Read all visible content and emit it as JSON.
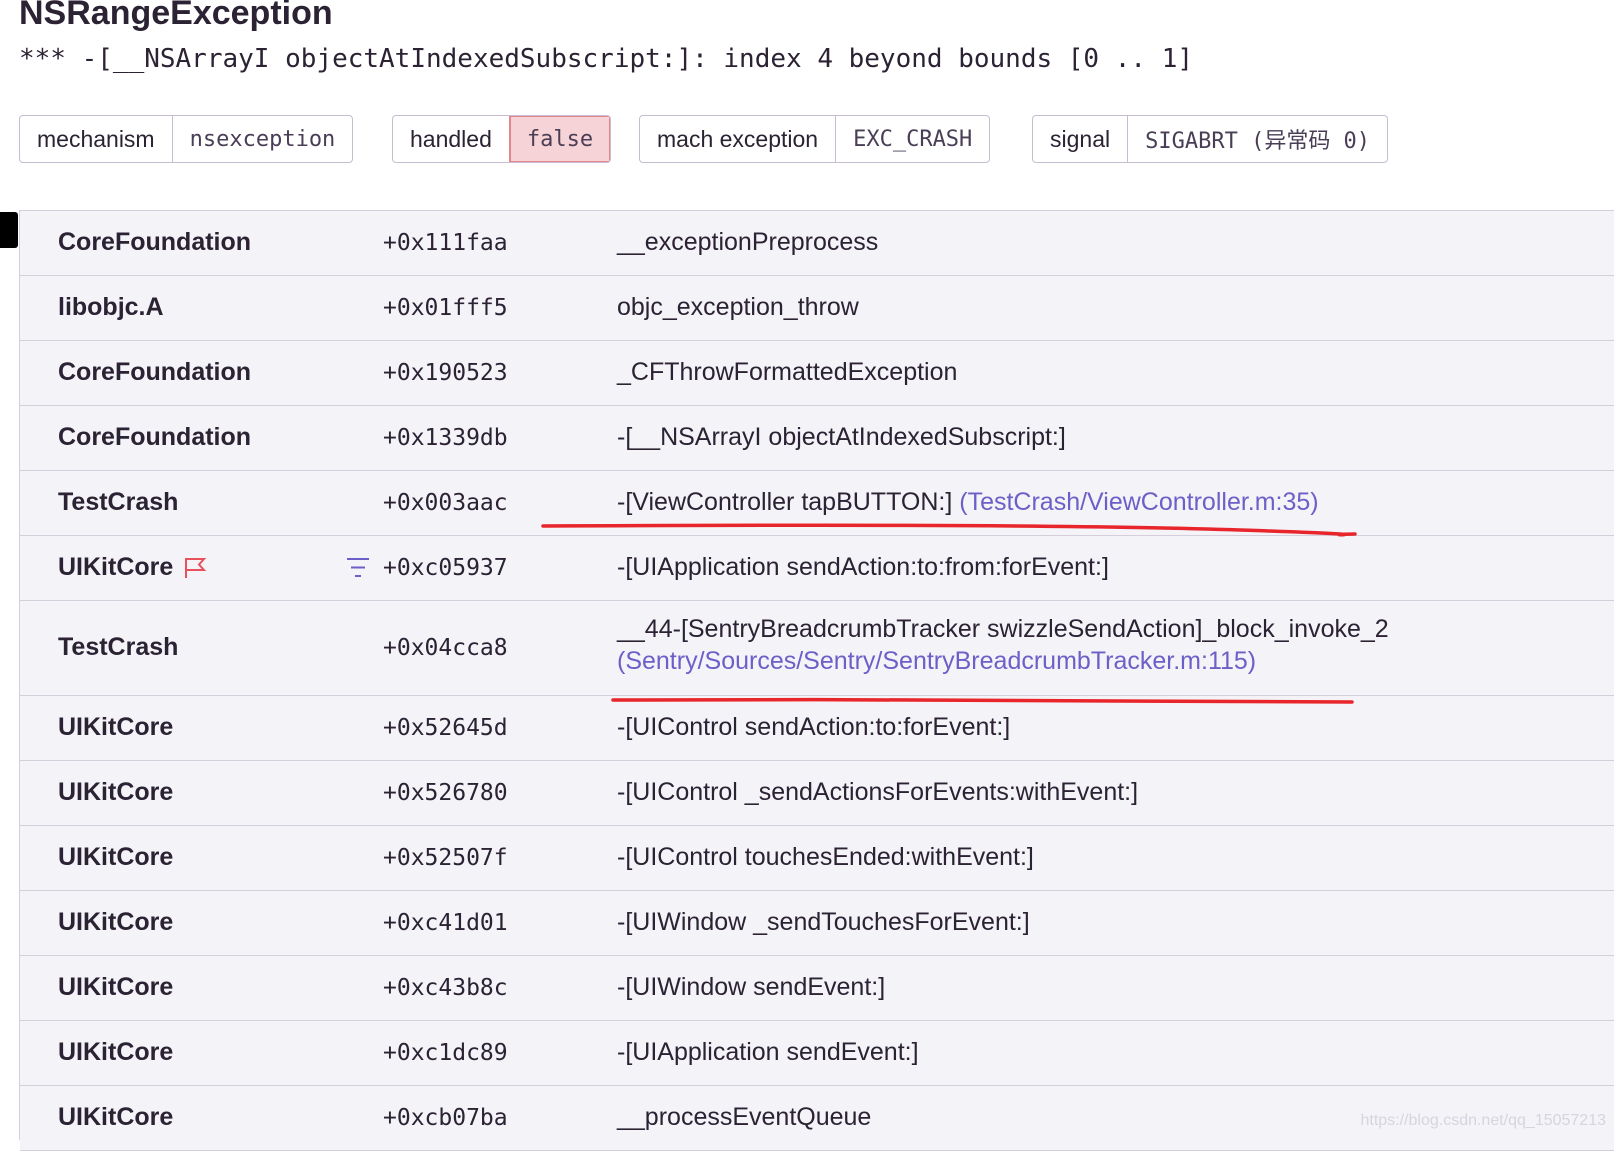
{
  "exception": {
    "type": "NSRangeException",
    "message": "*** -[__NSArrayI objectAtIndexedSubscript:]: index 4 beyond bounds [0 .. 1]"
  },
  "tags": [
    {
      "key": "mechanism",
      "value": "nsexception",
      "highlight": false
    },
    {
      "key": "handled",
      "value": "false",
      "highlight": true
    },
    {
      "key": "mach exception",
      "value": "EXC_CRASH",
      "highlight": false
    },
    {
      "key": "signal",
      "value": "SIGABRT (异常码 0)",
      "highlight": false
    }
  ],
  "frames": [
    {
      "package": "CoreFoundation",
      "address": "+0x111faa",
      "function": "__exceptionPreprocess"
    },
    {
      "package": "libobjc.A",
      "address": "+0x01fff5",
      "function": "objc_exception_throw"
    },
    {
      "package": "CoreFoundation",
      "address": "+0x190523",
      "function": "_CFThrowFormattedException"
    },
    {
      "package": "CoreFoundation",
      "address": "+0x1339db",
      "function": "-[__NSArrayI objectAtIndexedSubscript:]"
    },
    {
      "package": "TestCrash",
      "address": "+0x003aac",
      "function": "-[ViewController tapBUTTON:]",
      "location": "(TestCrash/ViewController.m:35)"
    },
    {
      "package": "UIKitCore",
      "address": "+0xc05937",
      "function": "-[UIApplication sendAction:to:from:forEvent:]",
      "flag": true
    },
    {
      "package": "TestCrash",
      "address": "+0x04cca8",
      "function": "__44-[SentryBreadcrumbTracker swizzleSendAction]_block_invoke_2",
      "location": "(Sentry/Sources/Sentry/SentryBreadcrumbTracker.m:115)"
    },
    {
      "package": "UIKitCore",
      "address": "+0x52645d",
      "function": "-[UIControl sendAction:to:forEvent:]"
    },
    {
      "package": "UIKitCore",
      "address": "+0x526780",
      "function": "-[UIControl _sendActionsForEvents:withEvent:]"
    },
    {
      "package": "UIKitCore",
      "address": "+0x52507f",
      "function": "-[UIControl touchesEnded:withEvent:]"
    },
    {
      "package": "UIKitCore",
      "address": "+0xc41d01",
      "function": "-[UIWindow _sendTouchesForEvent:]"
    },
    {
      "package": "UIKitCore",
      "address": "+0xc43b8c",
      "function": "-[UIWindow sendEvent:]"
    },
    {
      "package": "UIKitCore",
      "address": "+0xc1dc89",
      "function": "-[UIApplication sendEvent:]"
    },
    {
      "package": "UIKitCore",
      "address": "+0xcb07ba",
      "function": "__processEventQueue"
    }
  ],
  "icons": {
    "apple": "apple-icon",
    "flag": "flag-icon",
    "list": "list-icon"
  },
  "colors": {
    "link": "#6c5fc7",
    "annotation": "#e8252a",
    "handled_false_bg": "#f6d3d6"
  },
  "watermark": "https://blog.csdn.net/qq_15057213"
}
